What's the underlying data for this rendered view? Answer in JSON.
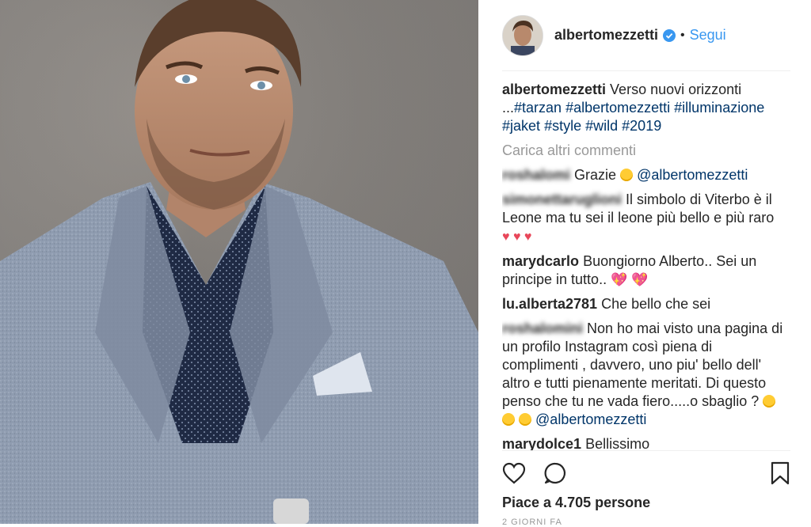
{
  "post": {
    "username": "albertomezzetti",
    "follow_label": "Segui",
    "separator": "•"
  },
  "caption": {
    "user": "albertomezzetti",
    "text": "Verso nuovi orizzonti ...",
    "hashtags": [
      "#tarzan",
      "#albertomezzetti",
      "#illuminazione",
      "#jaket",
      "#style",
      "#wild",
      "#2019"
    ]
  },
  "load_more": "Carica altri commenti",
  "comments": [
    {
      "user": "roshalomi",
      "text": "Grazie",
      "mention": "@albertomezzetti"
    },
    {
      "user": "simonettaruglioni",
      "text": "Il simbolo di Viterbo è il Leone ma tu sei il leone più bello e più raro"
    },
    {
      "user": "marydcarlo",
      "text": "Buongiorno Alberto.. Sei un principe in tutto.."
    },
    {
      "user": "lu.alberta2781",
      "text": "Che bello che sei"
    },
    {
      "user": "roshalomini",
      "text": "Non ho mai visto una pagina di un profilo Instagram così piena di complimenti , davvero, uno piu' bello dell' altro e tutti pienamente meritati. Di questo penso che tu ne vada fiero.....o sbaglio ?",
      "mention": "@albertomezzetti"
    },
    {
      "user": "marydolce1",
      "text": "Bellissimo"
    }
  ],
  "likes_label": "Piace a 4.705 persone",
  "time_label": "2 GIORNI FA",
  "colors": {
    "link": "#3897f0",
    "hashtag": "#003569",
    "muted": "#999999"
  }
}
